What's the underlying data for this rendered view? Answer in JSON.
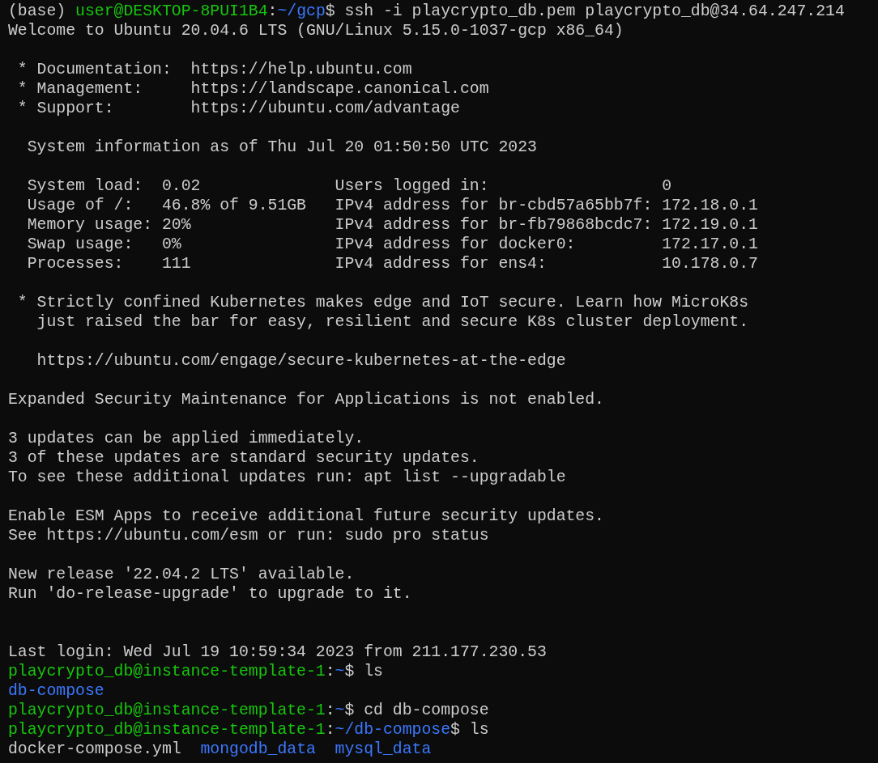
{
  "terminal": {
    "lines": [
      {
        "kind": "prompt",
        "user": "user@DESKTOP-8PUI1B4",
        "separator": ":",
        "path": "~/gcp",
        "prefix": "(base) ",
        "command": "$ ssh -i playcrypto_db.pem playcrypto_db@34.64.247.214"
      },
      {
        "kind": "text",
        "text": "Welcome to Ubuntu 20.04.6 LTS (GNU/Linux 5.15.0-1037-gcp x86_64)"
      },
      {
        "kind": "blank"
      },
      {
        "kind": "text",
        "text": " * Documentation:  https://help.ubuntu.com"
      },
      {
        "kind": "text",
        "text": " * Management:     https://landscape.canonical.com"
      },
      {
        "kind": "text",
        "text": " * Support:        https://ubuntu.com/advantage"
      },
      {
        "kind": "blank"
      },
      {
        "kind": "text",
        "text": "  System information as of Thu Jul 20 01:50:50 UTC 2023"
      },
      {
        "kind": "blank"
      },
      {
        "kind": "text",
        "text": "  System load:  0.02              Users logged in:                  0"
      },
      {
        "kind": "text",
        "text": "  Usage of /:   46.8% of 9.51GB   IPv4 address for br-cbd57a65bb7f: 172.18.0.1"
      },
      {
        "kind": "text",
        "text": "  Memory usage: 20%               IPv4 address for br-fb79868bcdc7: 172.19.0.1"
      },
      {
        "kind": "text",
        "text": "  Swap usage:   0%                IPv4 address for docker0:         172.17.0.1"
      },
      {
        "kind": "text",
        "text": "  Processes:    111               IPv4 address for ens4:            10.178.0.7"
      },
      {
        "kind": "blank"
      },
      {
        "kind": "text",
        "text": " * Strictly confined Kubernetes makes edge and IoT secure. Learn how MicroK8s"
      },
      {
        "kind": "text",
        "text": "   just raised the bar for easy, resilient and secure K8s cluster deployment."
      },
      {
        "kind": "blank"
      },
      {
        "kind": "text",
        "text": "   https://ubuntu.com/engage/secure-kubernetes-at-the-edge"
      },
      {
        "kind": "blank"
      },
      {
        "kind": "text",
        "text": "Expanded Security Maintenance for Applications is not enabled."
      },
      {
        "kind": "blank"
      },
      {
        "kind": "text",
        "text": "3 updates can be applied immediately."
      },
      {
        "kind": "text",
        "text": "3 of these updates are standard security updates."
      },
      {
        "kind": "text",
        "text": "To see these additional updates run: apt list --upgradable"
      },
      {
        "kind": "blank"
      },
      {
        "kind": "text",
        "text": "Enable ESM Apps to receive additional future security updates."
      },
      {
        "kind": "text",
        "text": "See https://ubuntu.com/esm or run: sudo pro status"
      },
      {
        "kind": "blank"
      },
      {
        "kind": "text",
        "text": "New release '22.04.2 LTS' available."
      },
      {
        "kind": "text",
        "text": "Run 'do-release-upgrade' to upgrade to it."
      },
      {
        "kind": "blank"
      },
      {
        "kind": "blank"
      },
      {
        "kind": "text",
        "text": "Last login: Wed Jul 19 10:59:34 2023 from 211.177.230.53"
      },
      {
        "kind": "prompt",
        "user": "playcrypto_db@instance-template-1",
        "separator": ":",
        "path": "~",
        "command": "$ ls"
      },
      {
        "kind": "listing",
        "entries": [
          {
            "name": "db-compose",
            "kind": "dir"
          }
        ]
      },
      {
        "kind": "prompt",
        "user": "playcrypto_db@instance-template-1",
        "separator": ":",
        "path": "~",
        "command": "$ cd db-compose"
      },
      {
        "kind": "prompt",
        "user": "playcrypto_db@instance-template-1",
        "separator": ":",
        "path": "~/db-compose",
        "command": "$ ls"
      },
      {
        "kind": "listing",
        "entries": [
          {
            "name": "docker-compose.yml",
            "kind": "file"
          },
          {
            "name": "mongodb_data",
            "kind": "dir"
          },
          {
            "name": "mysql_data",
            "kind": "dir"
          }
        ]
      }
    ]
  }
}
